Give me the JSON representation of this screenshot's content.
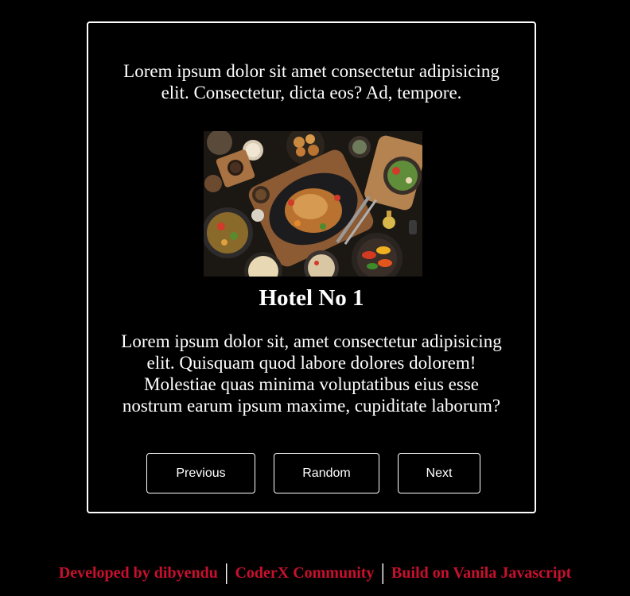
{
  "card": {
    "intro_text": "Lorem ipsum dolor sit amet consectetur adipisicing elit. Consectetur, dicta eos? Ad, tempore.",
    "title": "Hotel No 1",
    "description": "Lorem ipsum dolor sit, amet consectetur adipisicing elit. Quisquam quod labore dolores dolorem! Molestiae quas minima voluptatibus eius esse nostrum earum ipsum maxime, cupiditate laborum?",
    "buttons": {
      "previous": "Previous",
      "random": "Random",
      "next": "Next"
    }
  },
  "footer": {
    "author": "Developed by dibyendu",
    "separator": "|",
    "community": "CoderX Community",
    "built_with": "Build on Vanila Javascript"
  },
  "colors": {
    "background": "#000000",
    "text": "#ffffff",
    "accent": "#c8102e"
  }
}
